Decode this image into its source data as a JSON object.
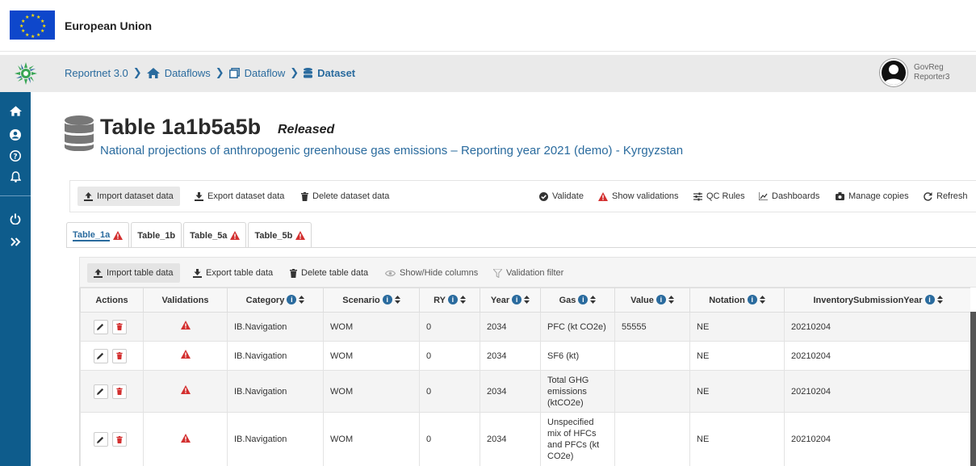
{
  "eu": {
    "title": "European Union"
  },
  "breadcrumb": {
    "items": [
      "Reportnet 3.0",
      "Dataflows",
      "Dataflow",
      "Dataset"
    ]
  },
  "user": {
    "line1": "GovReg",
    "line2": "Reporter3"
  },
  "header": {
    "title": "Table 1a1b5a5b",
    "status": "Released",
    "subtitle": "National projections of anthropogenic greenhouse gas emissions – Reporting year 2021 (demo) - Kyrgyzstan"
  },
  "dataset_toolbar": {
    "import": "Import dataset data",
    "export": "Export dataset data",
    "delete": "Delete dataset data",
    "validate": "Validate",
    "show_validations": "Show validations",
    "qc_rules": "QC Rules",
    "dashboards": "Dashboards",
    "manage_copies": "Manage copies",
    "refresh": "Refresh"
  },
  "tabs": [
    {
      "label": "Table_1a",
      "warning": true
    },
    {
      "label": "Table_1b",
      "warning": false
    },
    {
      "label": "Table_5a",
      "warning": true
    },
    {
      "label": "Table_5b",
      "warning": true
    }
  ],
  "table_toolbar": {
    "import": "Import table data",
    "export": "Export table data",
    "delete": "Delete table data",
    "columns": "Show/Hide columns",
    "filter": "Validation filter"
  },
  "columns": [
    "Actions",
    "Validations",
    "Category",
    "Scenario",
    "RY",
    "Year",
    "Gas",
    "Value",
    "Notation",
    "InventorySubmissionYear"
  ],
  "rows": [
    {
      "category": "IB.Navigation",
      "scenario": "WOM",
      "ry": "0",
      "year": "2034",
      "gas": [
        "PFC (kt CO2e)"
      ],
      "value": "55555",
      "notation": "NE",
      "isy": "20210204"
    },
    {
      "category": "IB.Navigation",
      "scenario": "WOM",
      "ry": "0",
      "year": "2034",
      "gas": [
        "SF6 (kt)"
      ],
      "value": "",
      "notation": "NE",
      "isy": "20210204"
    },
    {
      "category": "IB.Navigation",
      "scenario": "WOM",
      "ry": "0",
      "year": "2034",
      "gas": [
        "Total GHG",
        "emissions",
        "(ktCO2e)"
      ],
      "value": "",
      "notation": "NE",
      "isy": "20210204"
    },
    {
      "category": "IB.Navigation",
      "scenario": "WOM",
      "ry": "0",
      "year": "2034",
      "gas": [
        "Unspecified",
        "mix of HFCs",
        "and PFCs (kt",
        "CO2e)"
      ],
      "value": "",
      "notation": "NE",
      "isy": "20210204"
    }
  ],
  "colors": {
    "primary": "#2a6b9e",
    "sidebar": "#0e5c8c",
    "warning": "#d32f2f",
    "eu_blue": "#0e47cb",
    "eu_yellow": "#ffe100"
  }
}
